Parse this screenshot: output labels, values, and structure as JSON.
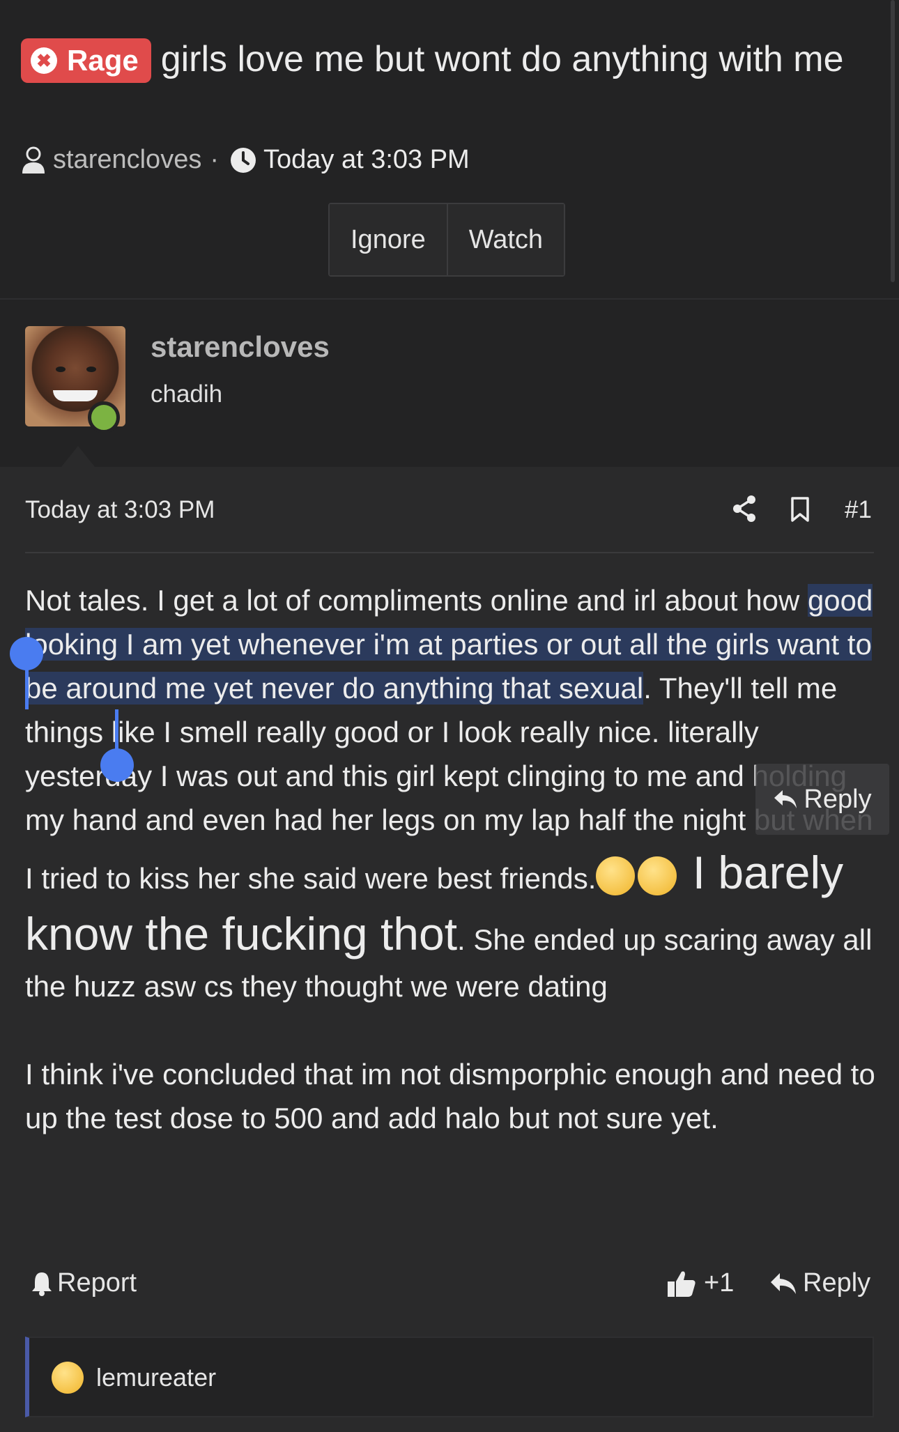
{
  "thread": {
    "prefix_label": "Rage",
    "title": "girls love me but wont do anything with me",
    "author": "starencloves",
    "meta_separator": "·",
    "timestamp": "Today at 3:03 PM",
    "ignore_label": "Ignore",
    "watch_label": "Watch"
  },
  "post": {
    "username": "starencloves",
    "user_title": "chadih",
    "timestamp": "Today at 3:03 PM",
    "post_number": "#1",
    "body": {
      "p1_a": "Not tales. I get a lot of compliments online and irl about how ",
      "p1_sel": "good looking I am yet whenever i'm at parties or out all the girls want to be around me yet never do anything that sexual",
      "p1_b": ". They'll tell me things like I smell really good or I look really nice. literally yesterday I was out and this girl kept clinging to me and holding my hand and even had her legs on my lap half the night but when I tried to kiss her she said were best friends.",
      "p1_big": " I barely know the fucking thot",
      "p1_c": ". She ended up scaring away all the huzz asw cs they thought we were dating",
      "p2": "I think i've concluded that im not dismporphic enough and need to up the test dose to 500 and add halo but not sure yet."
    },
    "report_label": "Report",
    "like_count": "+1",
    "reply_label": "Reply",
    "popup_reply_label": "Reply"
  },
  "quote": {
    "username": "lemureater"
  },
  "colors": {
    "rage_badge": "#e04b4b",
    "selection": "#2b3a5c",
    "selection_handle": "#4a7cf0",
    "online": "#7cb342",
    "quote_bar": "#4a5aa8"
  },
  "icons": [
    "angry-face-icon",
    "user-icon",
    "clock-icon",
    "share-icon",
    "bookmark-icon",
    "bell-icon",
    "thumbs-up-icon",
    "reply-icon",
    "worried-emoji-icon",
    "sad-emoji-icon"
  ]
}
